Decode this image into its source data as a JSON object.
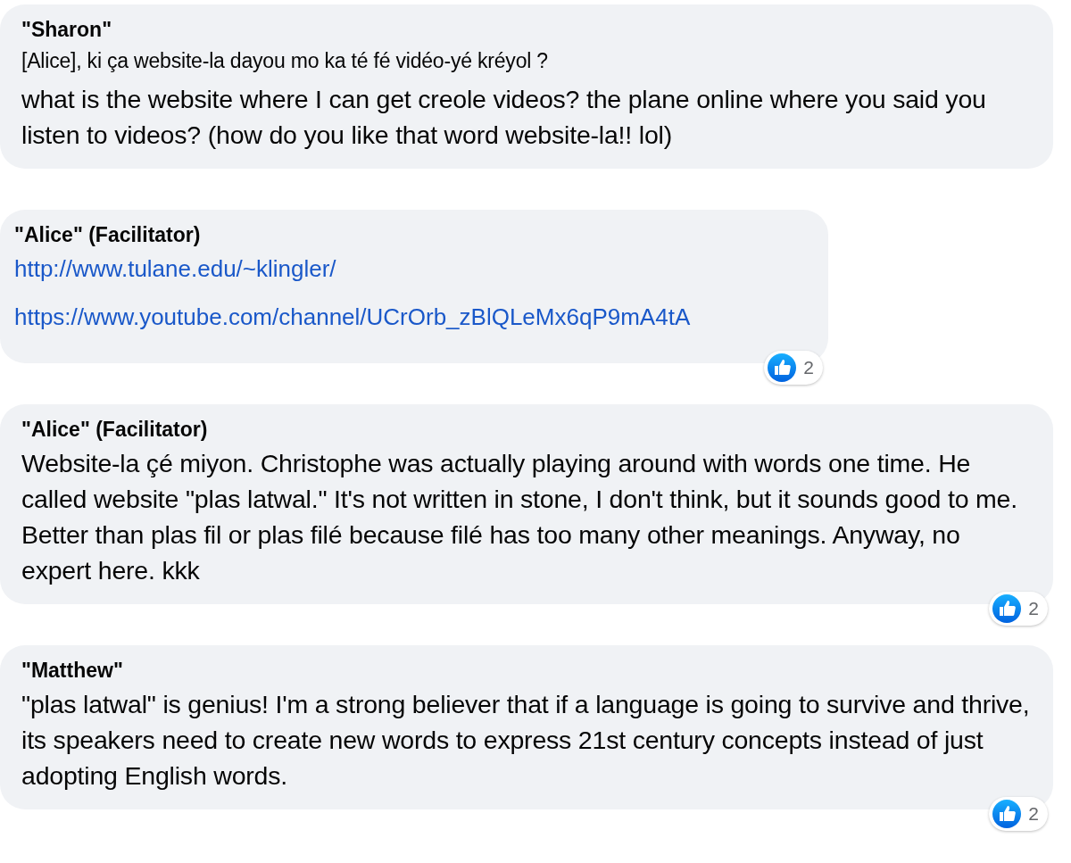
{
  "comments": [
    {
      "author": "\"Sharon\"",
      "wide": true,
      "paragraphs": [
        {
          "kind": "text",
          "small": true,
          "text": "[Alice], ki ça website-la dayou mo ka té fé vidéo-yé kréyol ?"
        },
        {
          "kind": "text",
          "small": false,
          "text": "what is the website where I can get creole videos? the plane online where you said you listen to videos? (how do you like that word website-la!! lol)"
        }
      ]
    },
    {
      "author": "\"Alice\" (Facilitator)",
      "wide": false,
      "paragraphs": [
        {
          "kind": "link",
          "text": "http://www.tulane.edu/~klingler/"
        },
        {
          "kind": "link",
          "text": "https://www.youtube.com/channel/UCrOrb_zBlQLeMx6qP9mA4tA"
        }
      ],
      "reactions": "2"
    },
    {
      "author": "\"Alice\" (Facilitator)",
      "wide": true,
      "paragraphs": [
        {
          "kind": "text",
          "small": false,
          "text": "Website-la çé miyon. Christophe was actually playing around with words one time. He called website \"plas latwal.\" It's not written in stone, I don't think, but it sounds good to me. Better than plas fil or plas filé because filé has too many other meanings. Anyway, no expert here. kkk"
        }
      ],
      "reactions": "2"
    },
    {
      "author": "\"Matthew\"",
      "wide": true,
      "paragraphs": [
        {
          "kind": "text",
          "small": false,
          "text": "\"plas latwal\" is genius! I'm a strong believer that if a language is going to survive and thrive, its speakers need to create new words to express 21st century concepts instead of just adopting English words."
        }
      ],
      "reactions": "2"
    }
  ]
}
